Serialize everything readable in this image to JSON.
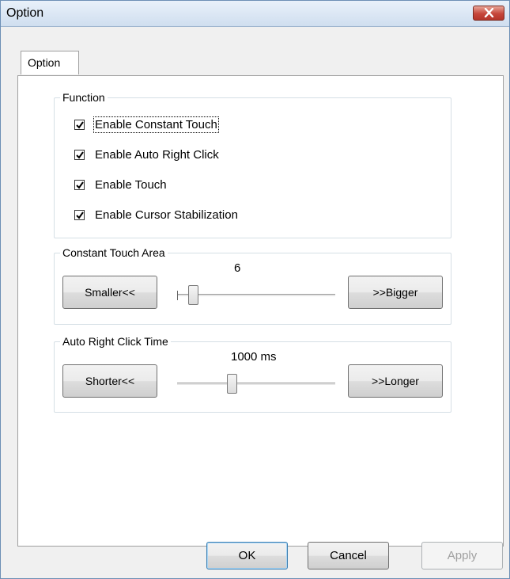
{
  "window": {
    "title": "Option",
    "close_icon": "close-icon"
  },
  "tabs": [
    {
      "label": "Option",
      "selected": true
    }
  ],
  "function_group": {
    "legend": "Function",
    "items": [
      {
        "label": "Enable Constant Touch",
        "checked": true
      },
      {
        "label": "Enable Auto Right Click",
        "checked": true
      },
      {
        "label": "Enable Touch",
        "checked": true
      },
      {
        "label": "Enable Cursor Stabilization",
        "checked": true
      }
    ]
  },
  "touch_area": {
    "legend": "Constant Touch Area",
    "value_label": "6",
    "smaller_label": "Smaller<<",
    "bigger_label": ">>Bigger"
  },
  "right_click_time": {
    "legend": "Auto Right Click Time",
    "value_label": "1000 ms",
    "shorter_label": "Shorter<<",
    "longer_label": ">>Longer"
  },
  "dialog_buttons": {
    "ok": "OK",
    "cancel": "Cancel",
    "apply": "Apply"
  },
  "colors": {
    "title_gradient_top": "#e9f1fa",
    "close_button_red": "#c6463a",
    "default_button_border": "#3c7fb1"
  }
}
